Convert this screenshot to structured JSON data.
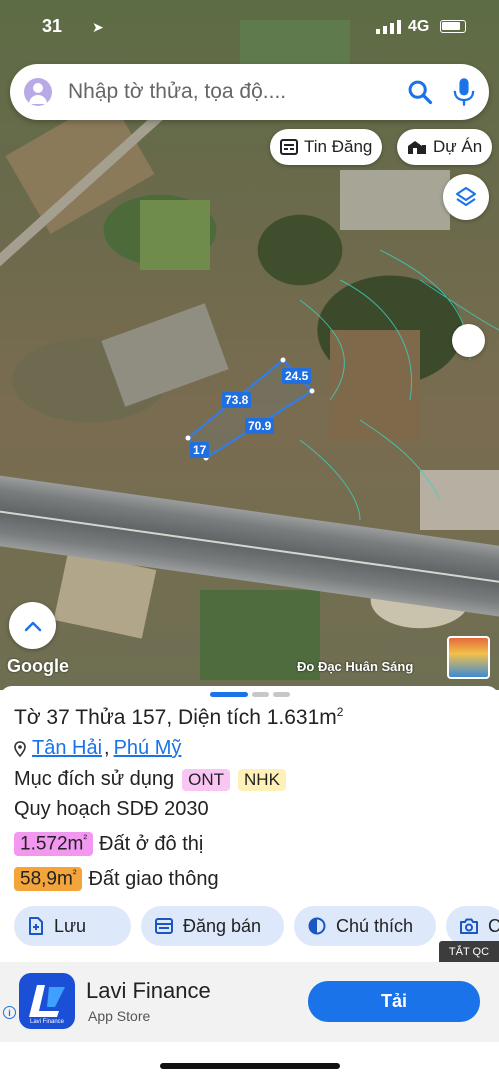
{
  "status_bar": {
    "time": "31",
    "network": "4G"
  },
  "search": {
    "placeholder": "Nhập tờ thửa, tọa độ...."
  },
  "chips": {
    "news_label": "Tin Đăng",
    "projects_label": "Dự Án"
  },
  "map": {
    "dimensions": {
      "top": "73.8",
      "right": "24.5",
      "bottom": "70.9",
      "left": "17"
    },
    "google_label": "Google",
    "credit": "Đo Đạc Huân Sáng"
  },
  "parcel": {
    "title_prefix": "Tờ 37 Thửa 157, Diện tích 1.631m",
    "title_sup": "2",
    "location_ward": "Tân Hải",
    "location_sep": ",",
    "location_district": "Phú Mỹ",
    "use_label": "Mục đích sử dụng",
    "use_tags": [
      "ONT",
      "NHK"
    ],
    "plan_label": "Quy hoạch SDĐ 2030",
    "areas": [
      {
        "value": "1.572m",
        "sup": "²",
        "label": "Đất ở đô thị",
        "color": "#f398f0"
      },
      {
        "value": "58,9m",
        "sup": "²",
        "label": "Đất giao thông",
        "color": "#f3a43b"
      }
    ]
  },
  "actions": {
    "save": "Lưu",
    "post": "Đăng bán",
    "legend": "Chú thích",
    "camera": "C"
  },
  "ad": {
    "close_label": "TẮT QC",
    "app_name": "Lavi Finance",
    "store": "App Store",
    "install_label": "Tải",
    "icon_text": "Lavi Finance"
  }
}
